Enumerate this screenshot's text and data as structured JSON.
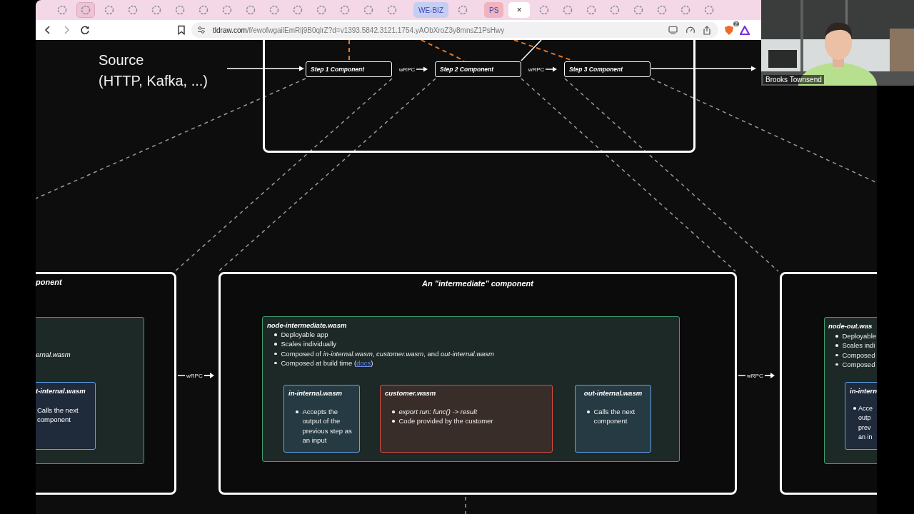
{
  "browser": {
    "tabs": [
      {
        "kind": "icon",
        "selected": false
      },
      {
        "kind": "icon",
        "selected": true
      },
      {
        "kind": "icon",
        "selected": false
      },
      {
        "kind": "icon",
        "selected": false
      },
      {
        "kind": "icon",
        "selected": false
      },
      {
        "kind": "icon",
        "selected": false
      },
      {
        "kind": "icon",
        "selected": false
      },
      {
        "kind": "icon",
        "selected": false
      },
      {
        "kind": "icon",
        "selected": false
      },
      {
        "kind": "icon",
        "selected": false
      },
      {
        "kind": "icon",
        "selected": false
      },
      {
        "kind": "icon",
        "selected": false
      },
      {
        "kind": "icon",
        "selected": false
      },
      {
        "kind": "icon",
        "selected": false
      },
      {
        "kind": "icon",
        "selected": false
      },
      {
        "kind": "label",
        "label": "WE-BIZ",
        "color": "#c5cdf3",
        "selected": false
      },
      {
        "kind": "icon",
        "selected": false
      },
      {
        "kind": "label",
        "label": "PS",
        "color": "#f1b3bd",
        "selected": false
      },
      {
        "kind": "close",
        "label": "×",
        "selected": true
      },
      {
        "kind": "icon",
        "selected": false
      },
      {
        "kind": "icon",
        "selected": false
      },
      {
        "kind": "icon",
        "selected": false
      },
      {
        "kind": "icon",
        "selected": false
      },
      {
        "kind": "icon",
        "selected": false
      },
      {
        "kind": "icon",
        "selected": false
      },
      {
        "kind": "icon",
        "selected": false
      },
      {
        "kind": "icon",
        "selected": false
      }
    ],
    "url": "tldraw.com/f/ewofwgailEmRlj9B0qlrZ?d=v1393.5842.3121.1754.yAObXroZ3y8mnsZ1PsHwy",
    "extension_badge": "2"
  },
  "video": {
    "name": "Brooks Townsend"
  },
  "diagram": {
    "source": "Source\n(HTTP, Kafka, ...)",
    "steps": [
      "Step 1 Component",
      "Step 2 Component",
      "Step 3 Component"
    ],
    "step_links": [
      "wRPC",
      "wRPC"
    ],
    "panel_links": [
      "wRPC",
      "wRPC"
    ],
    "left_panel": {
      "title": "ponent",
      "node_text": "ernal.wasm",
      "sub_title": "t-internal.wasm",
      "sub_text": "Calls the next component"
    },
    "middle_panel": {
      "title": "An \"intermediate\" component",
      "node_title": "node-intermediate.wasm",
      "bullets": [
        {
          "text": "Deployable app"
        },
        {
          "text": "Scales individually"
        },
        {
          "text": "Composed of *in-internal.wasm*, *customer.wasm*, and *out-internal.wasm*"
        },
        {
          "text": "Composed at build time (",
          "link": "docs",
          "after": ")"
        }
      ],
      "modules": [
        {
          "title": "in-internal.wasm",
          "color": "#5fa3ee",
          "bullets": [
            "Accepts the output of the previous step as an input"
          ]
        },
        {
          "title": "customer.wasm",
          "color": "#dc4a42",
          "bullets": [
            "*export run: func() -> result*",
            "Code provided by the customer"
          ]
        },
        {
          "title": "out-internal.wasm",
          "color": "#5fa3ee",
          "bullets": [
            "Calls the next component"
          ]
        }
      ]
    },
    "right_panel": {
      "node_title": "node-out.was",
      "bullets": [
        "Deployable",
        "Scales indi",
        "Composed",
        "Composed"
      ],
      "sub_title": "in-intern",
      "sub_text": "Acce\noutp\nprev\nan in"
    }
  }
}
